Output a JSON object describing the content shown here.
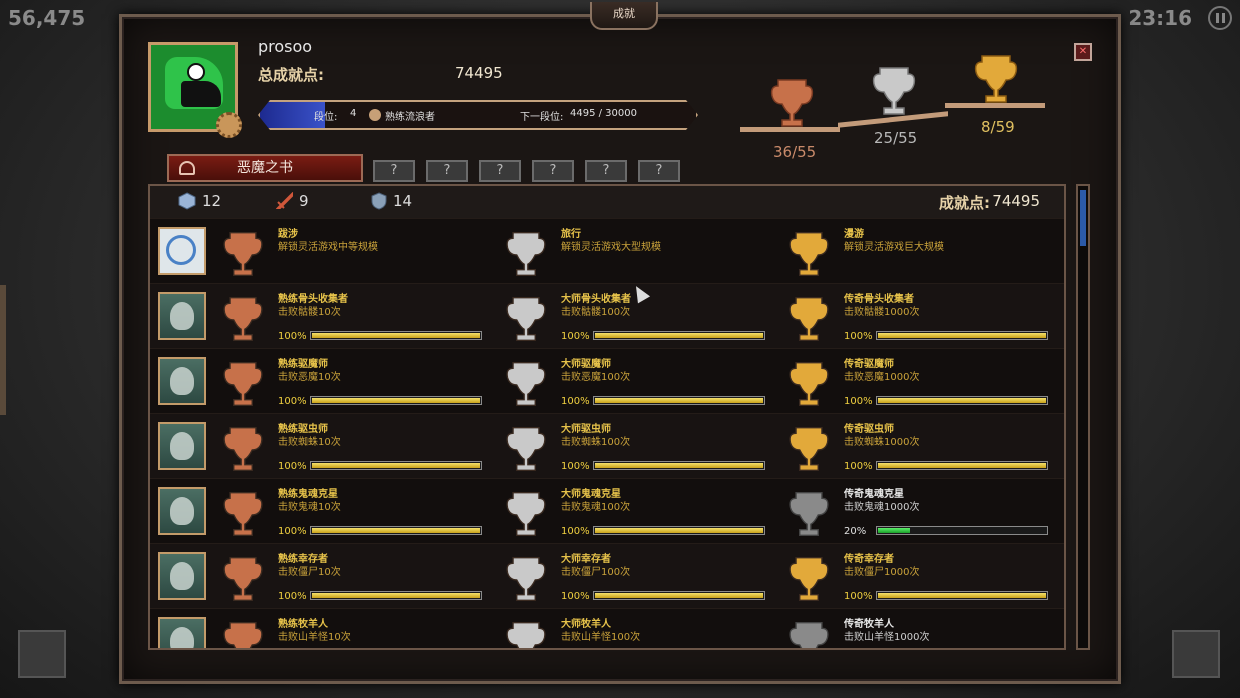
{
  "hud": {
    "score": "56,475",
    "time": "23:16"
  },
  "window": {
    "title": "成就"
  },
  "player": {
    "name": "prosoo",
    "total_label": "总成就点:",
    "total_points": "74495",
    "rank_label": "段位:",
    "rank_value": "4",
    "rank_name": "熟练流浪者",
    "next_rank_label": "下一段位:",
    "next_rank_progress": "4495 / 30000",
    "rank_fill_fraction": 0.15
  },
  "trophy_summary": [
    {
      "tier": "bronze",
      "count": "36/55",
      "color": "#c98a6a"
    },
    {
      "tier": "silver",
      "count": "25/55",
      "color": "#b8b8b8"
    },
    {
      "tier": "gold",
      "count": "8/59",
      "color": "#e0c060"
    }
  ],
  "tabs": {
    "active": "恶魔之书",
    "locked": [
      "?",
      "?",
      "?",
      "?",
      "?",
      "?"
    ]
  },
  "list_summary": {
    "cube_count": "12",
    "sword_count": "9",
    "shield_count": "14",
    "points_label": "成就点:",
    "points_value": "74495"
  },
  "rows": [
    {
      "icon": "compass-icon",
      "cells": [
        {
          "tier": "bronze",
          "title": "跋涉",
          "desc": "解锁灵活游戏中等规模",
          "unlocked": true
        },
        {
          "tier": "silver",
          "title": "旅行",
          "desc": "解锁灵活游戏大型规模",
          "unlocked": true
        },
        {
          "tier": "gold",
          "title": "漫游",
          "desc": "解锁灵活游戏巨大规模",
          "unlocked": true
        }
      ]
    },
    {
      "icon": "skull-icon",
      "cells": [
        {
          "tier": "bronze",
          "title": "熟练骨头收集者",
          "desc": "击败骷髅10次",
          "pct": "100%",
          "progress": 1,
          "unlocked": true
        },
        {
          "tier": "silver",
          "title": "大师骨头收集者",
          "desc": "击败骷髅100次",
          "pct": "100%",
          "progress": 1,
          "unlocked": true
        },
        {
          "tier": "gold",
          "title": "传奇骨头收集者",
          "desc": "击败骷髅1000次",
          "pct": "100%",
          "progress": 1,
          "unlocked": true
        }
      ]
    },
    {
      "icon": "demon-icon",
      "cells": [
        {
          "tier": "bronze",
          "title": "熟练驱魔师",
          "desc": "击败恶魔10次",
          "pct": "100%",
          "progress": 1,
          "unlocked": true
        },
        {
          "tier": "silver",
          "title": "大师驱魔师",
          "desc": "击败恶魔100次",
          "pct": "100%",
          "progress": 1,
          "unlocked": true
        },
        {
          "tier": "gold",
          "title": "传奇驱魔师",
          "desc": "击败恶魔1000次",
          "pct": "100%",
          "progress": 1,
          "unlocked": true
        }
      ]
    },
    {
      "icon": "spider-icon",
      "cells": [
        {
          "tier": "bronze",
          "title": "熟练驱虫师",
          "desc": "击败蜘蛛10次",
          "pct": "100%",
          "progress": 1,
          "unlocked": true
        },
        {
          "tier": "silver",
          "title": "大师驱虫师",
          "desc": "击败蜘蛛100次",
          "pct": "100%",
          "progress": 1,
          "unlocked": true
        },
        {
          "tier": "gold",
          "title": "传奇驱虫师",
          "desc": "击败蜘蛛1000次",
          "pct": "100%",
          "progress": 1,
          "unlocked": true
        }
      ]
    },
    {
      "icon": "ghost-icon",
      "cells": [
        {
          "tier": "bronze",
          "title": "熟练鬼魂克星",
          "desc": "击败鬼魂10次",
          "pct": "100%",
          "progress": 1,
          "unlocked": true
        },
        {
          "tier": "silver",
          "title": "大师鬼魂克星",
          "desc": "击败鬼魂100次",
          "pct": "100%",
          "progress": 1,
          "unlocked": true
        },
        {
          "tier": "gold",
          "title": "传奇鬼魂克星",
          "desc": "击败鬼魂1000次",
          "pct": "20%",
          "progress": 0.2,
          "unlocked": false
        }
      ]
    },
    {
      "icon": "zombie-icon",
      "cells": [
        {
          "tier": "bronze",
          "title": "熟练幸存者",
          "desc": "击败僵尸10次",
          "pct": "100%",
          "progress": 1,
          "unlocked": true
        },
        {
          "tier": "silver",
          "title": "大师幸存者",
          "desc": "击败僵尸100次",
          "pct": "100%",
          "progress": 1,
          "unlocked": true
        },
        {
          "tier": "gold",
          "title": "传奇幸存者",
          "desc": "击败僵尸1000次",
          "pct": "100%",
          "progress": 1,
          "unlocked": true
        }
      ]
    },
    {
      "icon": "goat-icon",
      "cells": [
        {
          "tier": "bronze",
          "title": "熟练牧羊人",
          "desc": "击败山羊怪10次",
          "unlocked": true
        },
        {
          "tier": "silver",
          "title": "大师牧羊人",
          "desc": "击败山羊怪100次",
          "unlocked": true
        },
        {
          "tier": "gold",
          "title": "传奇牧羊人",
          "desc": "击败山羊怪1000次",
          "unlocked": false
        }
      ]
    }
  ],
  "colors": {
    "bronze": "#c7714a",
    "silver": "#c9c9c9",
    "gold": "#e2a93a",
    "locked": "#8a8a8a",
    "accent_gold_text": "#e6c24a"
  }
}
